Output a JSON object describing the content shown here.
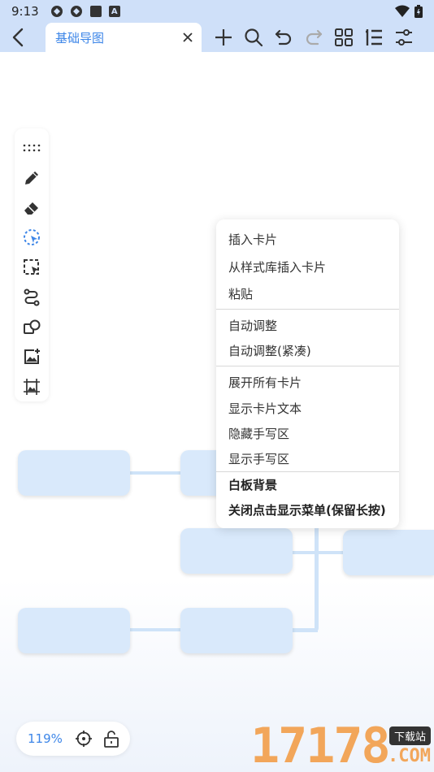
{
  "status_bar": {
    "time": "9:13",
    "notification_badge": "A"
  },
  "header": {
    "tab_title": "基础导图",
    "icons": [
      "back-icon",
      "close-icon",
      "add-icon",
      "search-icon",
      "undo-icon",
      "redo-icon",
      "grid-icon",
      "outline-icon",
      "settings-sliders-icon"
    ]
  },
  "left_toolbar": {
    "icons": [
      "drag-handle-icon",
      "pen-icon",
      "eraser-icon",
      "lasso-select-icon",
      "box-select-icon",
      "connector-icon",
      "shapes-icon",
      "insert-image-icon",
      "background-image-icon"
    ]
  },
  "context_menu": {
    "groups": [
      [
        "插入卡片",
        "从样式库插入卡片",
        "粘贴"
      ],
      [
        "自动调整",
        "自动调整(紧凑)"
      ],
      [
        "展开所有卡片",
        "显示卡片文本",
        "隐藏手写区",
        "显示手写区"
      ],
      [
        "白板背景",
        "关闭点击显示菜单(保留长按)"
      ]
    ]
  },
  "zoom": {
    "level": "119%"
  },
  "watermark": {
    "number": "17178",
    "tag": "下载站",
    "domain": ".COM"
  },
  "colors": {
    "accent": "#3d86e8",
    "card": "#d9e9fb",
    "header": "#cfe0f9"
  }
}
